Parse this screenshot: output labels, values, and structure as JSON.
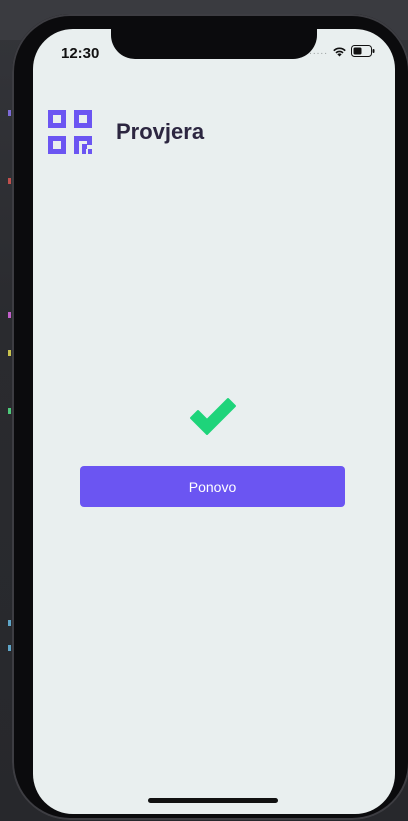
{
  "status_bar": {
    "time": "12:30",
    "signal": "....."
  },
  "header": {
    "title": "Provjera",
    "logo_icon": "qr-code-icon",
    "accent_color": "#6b55f2"
  },
  "result": {
    "icon": "check-icon",
    "icon_color": "#1ed47a"
  },
  "actions": {
    "retry_label": "Ponovo"
  }
}
